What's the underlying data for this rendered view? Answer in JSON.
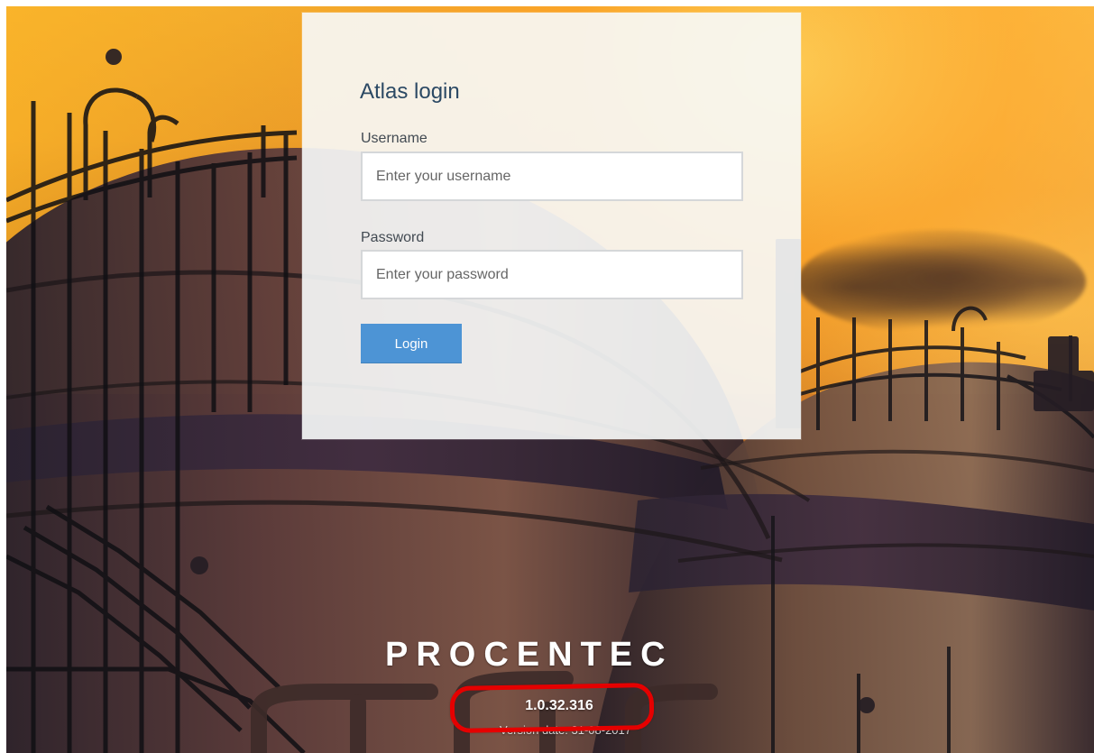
{
  "login": {
    "title": "Atlas login",
    "username": {
      "label": "Username",
      "placeholder": "Enter your username",
      "value": ""
    },
    "password": {
      "label": "Password",
      "placeholder": "Enter your password",
      "value": ""
    },
    "button_label": "Login"
  },
  "footer": {
    "brand": "PROCENTEC",
    "version": "1.0.32.316",
    "version_date": "Version date: 31-08-2017"
  },
  "annotation": {
    "highlight_color": "#e50000"
  },
  "theme": {
    "primary": "#4d94d5",
    "title": "#2b4964",
    "panel": "#f7f9fa"
  }
}
